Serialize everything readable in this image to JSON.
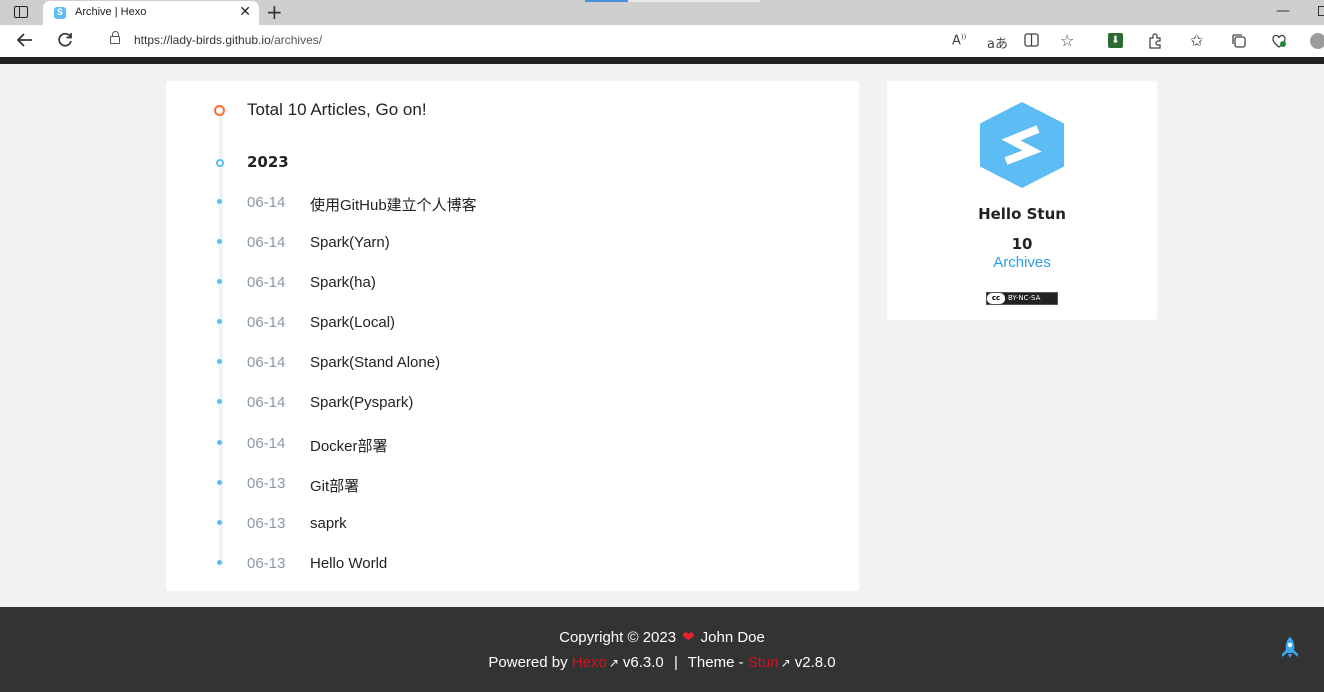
{
  "browser": {
    "tab_title": "Archive | Hexo",
    "tab_close": "✕",
    "new_tab": "+",
    "url_host": "https://lady-birds.github.io",
    "url_path": "/archives/",
    "icons": [
      "sidebar-toggle-icon",
      "tab-favicon",
      "back-icon",
      "refresh-icon",
      "lock-icon",
      "read-aloud-icon",
      "translate-icon",
      "split-screen-icon",
      "favorite-icon",
      "extension-download-icon",
      "extensions-icon",
      "favorites-icon",
      "collections-icon",
      "browser-essentials-icon",
      "profile-icon"
    ]
  },
  "archive": {
    "total_text": "Total 10 Articles, Go on!",
    "year": "2023",
    "posts": [
      {
        "date": "06-14",
        "title": "使用GitHub建立个人博客"
      },
      {
        "date": "06-14",
        "title": "Spark(Yarn)"
      },
      {
        "date": "06-14",
        "title": "Spark(ha)"
      },
      {
        "date": "06-14",
        "title": "Spark(Local)"
      },
      {
        "date": "06-14",
        "title": "Spark(Stand Alone)"
      },
      {
        "date": "06-14",
        "title": "Spark(Pyspark)"
      },
      {
        "date": "06-14",
        "title": "Docker部署"
      },
      {
        "date": "06-13",
        "title": "Git部署"
      },
      {
        "date": "06-13",
        "title": "saprk"
      },
      {
        "date": "06-13",
        "title": "Hello World"
      }
    ]
  },
  "sidebar": {
    "name": "Hello Stun",
    "count": "10",
    "count_label": "Archives",
    "license": "BY-NC-SA",
    "license_logo": "cc"
  },
  "footer": {
    "copyright": "Copyright © 2023",
    "author": "John Doe",
    "powered_by": "Powered by",
    "hexo": "Hexo",
    "hexo_version": "v6.3.0",
    "sep": "|",
    "theme": "Theme -",
    "stun": "Stun",
    "stun_version": "v2.8.0"
  },
  "colors": {
    "accent_blue": "#5bbdf3",
    "link_blue": "#2c9de6",
    "timeline_orange": "#ff6c2f",
    "footer_bg": "#333333",
    "footer_red": "#d4121e"
  }
}
